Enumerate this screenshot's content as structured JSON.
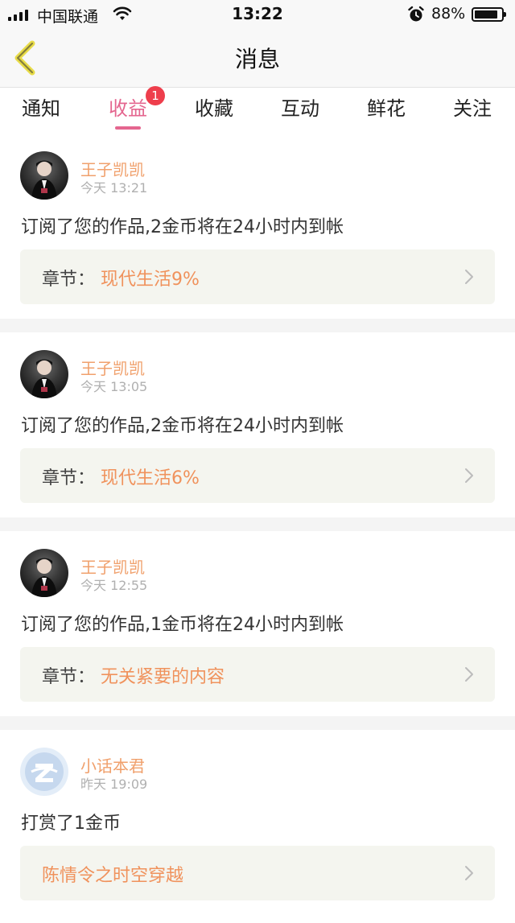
{
  "status_bar": {
    "carrier": "中国联通",
    "time": "13:22",
    "battery": "88%",
    "battery_level": 0.88
  },
  "navbar": {
    "title": "消息"
  },
  "tabs": [
    {
      "label": "通知",
      "active": false
    },
    {
      "label": "收益",
      "active": true,
      "badge": "1"
    },
    {
      "label": "收藏",
      "active": false
    },
    {
      "label": "互动",
      "active": false
    },
    {
      "label": "鲜花",
      "active": false
    },
    {
      "label": "关注",
      "active": false
    }
  ],
  "feed": [
    {
      "user": "王子凯凯",
      "time": "今天 13:21",
      "message": "订阅了您的作品,2金币将在24小时内到帐",
      "chapter_label": "章节：",
      "chapter_value": "现代生活9%"
    },
    {
      "user": "王子凯凯",
      "time": "今天 13:05",
      "message": "订阅了您的作品,2金币将在24小时内到帐",
      "chapter_label": "章节：",
      "chapter_value": "现代生活6%"
    },
    {
      "user": "王子凯凯",
      "time": "今天 12:55",
      "message": "订阅了您的作品,1金币将在24小时内到帐",
      "chapter_label": "章节：",
      "chapter_value": "无关紧要的内容"
    },
    {
      "user": "小话本君",
      "time": "昨天 19:09",
      "message": "打赏了1金币",
      "chapter_value": "陈情令之时空穿越"
    }
  ],
  "colors": {
    "accent": "#e4668f",
    "name": "#f0a06c",
    "chapter_value": "#f0925c",
    "badge": "#ee3e4c"
  }
}
